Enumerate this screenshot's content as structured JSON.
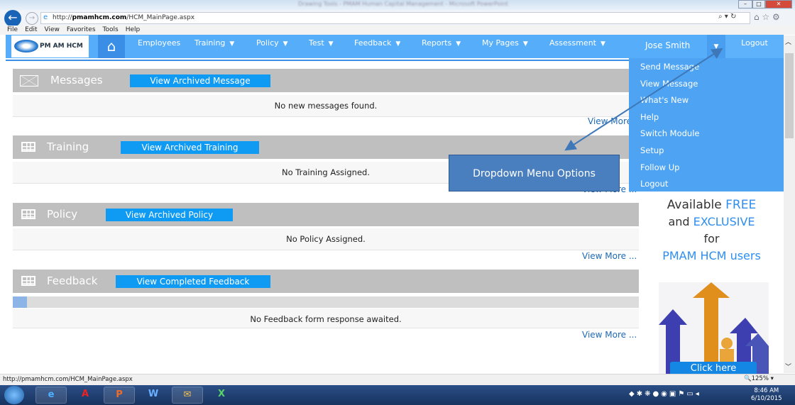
{
  "browser": {
    "title": "Drawing Tools - PMAM Human Capital Management - Microsoft PowerPoint",
    "url_prefix": "http://",
    "url_domain": "pmamhcm.com",
    "url_path": "/HCM_MainPage.aspx",
    "menu": [
      "File",
      "Edit",
      "View",
      "Favorites",
      "Tools",
      "Help"
    ],
    "status_url": "http://pmamhcm.com/HCM_MainPage.aspx",
    "zoom": "125%"
  },
  "nav": {
    "logo": "PM AM HCM",
    "items": [
      "Employees",
      "Training",
      "Policy",
      "Test",
      "Feedback",
      "Reports",
      "My Pages",
      "Assessment"
    ],
    "user": "Jose Smith",
    "logout": "Logout"
  },
  "dropdown": [
    "Send Message",
    "View Message",
    "What's New",
    "Help",
    "Switch Module",
    "Setup",
    "Follow Up",
    "Logout"
  ],
  "callout": "Dropdown Menu Options",
  "sections": [
    {
      "title": "Messages",
      "button": "View Archived Message",
      "empty": "No new messages found.",
      "more": "View More ..."
    },
    {
      "title": "Training",
      "button": "View Archived Training",
      "empty": "No Training Assigned.",
      "more": "View More ..."
    },
    {
      "title": "Policy",
      "button": "View Archived Policy",
      "empty": "No Policy Assigned.",
      "more": "View More ..."
    },
    {
      "title": "Feedback",
      "button": "View Completed Feedback",
      "empty": "No Feedback form response awaited.",
      "more": "View More ..."
    }
  ],
  "ad": {
    "l1a": "Available ",
    "l1b": "FREE",
    "l2a": "and ",
    "l2b": "EXCLUSIVE",
    "l3": "for",
    "l4": "PMAM HCM users",
    "cta": "Click here"
  },
  "taskbar": {
    "time": "8:46 AM",
    "date": "6/10/2015"
  },
  "colors": {
    "nav": "#56aefa",
    "button": "#0f9af3",
    "header": "#bfbfbf",
    "callout": "#4a7fbf"
  }
}
